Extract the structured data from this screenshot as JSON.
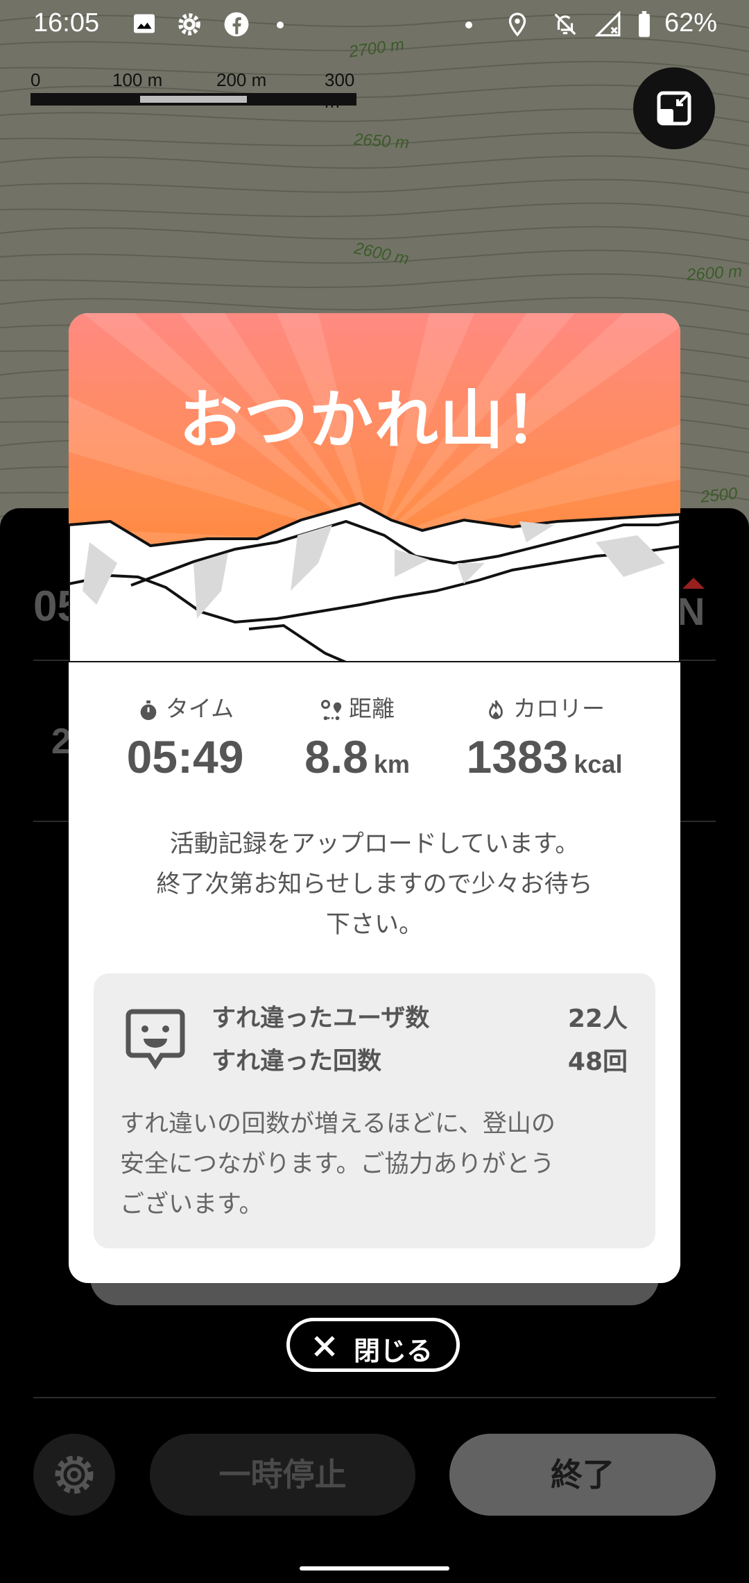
{
  "status_bar": {
    "time": "16:05",
    "battery": "62%",
    "left_icons": [
      "image-icon",
      "gear-icon",
      "facebook-icon",
      "dot-icon"
    ],
    "right_icons": [
      "dot-icon",
      "location-icon",
      "bell-off-icon",
      "signal-off-icon",
      "battery-icon"
    ]
  },
  "map": {
    "scale_labels": [
      "0",
      "100 m",
      "200 m",
      "300 m"
    ],
    "contour_labels": [
      "2700 m",
      "2650 m",
      "2600 m",
      "2600 m",
      "2500"
    ]
  },
  "background_panel": {
    "elapsed_partial": "05",
    "value_partial": "2",
    "north_label": "N",
    "pause_label": "一時停止",
    "end_label": "終了"
  },
  "dialog": {
    "title": "おつかれ山！",
    "stats": [
      {
        "label": "タイム",
        "value": "05:49",
        "unit": "",
        "icon": "stopwatch-icon"
      },
      {
        "label": "距離",
        "value": "8.8",
        "unit": "km",
        "icon": "route-icon"
      },
      {
        "label": "カロリー",
        "value": "1383",
        "unit": "kcal",
        "icon": "flame-icon"
      }
    ],
    "message_lines": [
      "活動記録をアップロードしています。",
      "終了次第お知らせしますので少々お待ち",
      "下さい。"
    ],
    "passing": {
      "icon": "speech-face-icon",
      "users_label": "すれ違ったユーザ数",
      "users_value": "22人",
      "count_label": "すれ違った回数",
      "count_value": "48回",
      "note_lines": [
        "すれ違いの回数が増えるほどに、登山の",
        "安全につながります。ご協力ありがとう",
        "ございます。"
      ]
    }
  },
  "close_button": {
    "label": "閉じる"
  },
  "colors": {
    "hero_top": "#ff8a80",
    "hero_bottom": "#ff7a2e",
    "map_bg": "#727366",
    "text_gray": "#555555"
  }
}
